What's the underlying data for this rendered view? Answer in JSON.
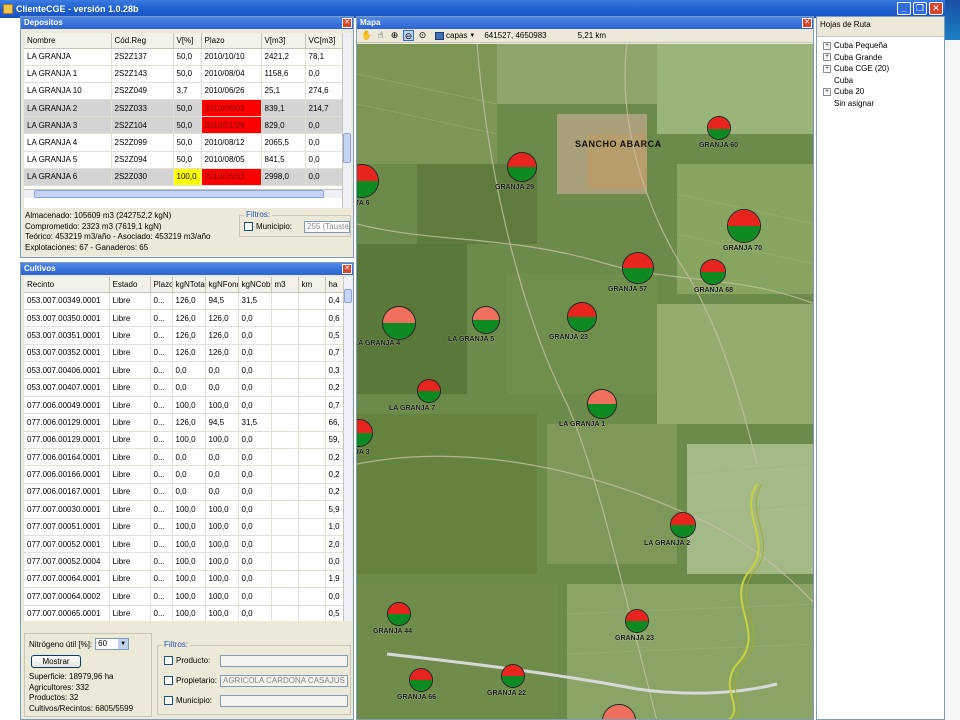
{
  "app": {
    "title": "ClienteCGE - versión 1.0.28b"
  },
  "window_controls": {
    "minimize": "_",
    "restore": "❐",
    "close": "✕"
  },
  "depositos": {
    "title": "Depositos",
    "columns": [
      "Nombre",
      "Cód.Reg",
      "V[%]",
      "Plazo",
      "V[m3]",
      "VC[m3]"
    ],
    "rows": [
      {
        "cells": [
          "LA GRANJA",
          "2S2Z137",
          "50,0",
          "2010/10/10",
          "2421,2",
          "78,1"
        ],
        "selected": false,
        "hl": [
          "",
          "",
          "",
          "",
          "",
          ""
        ]
      },
      {
        "cells": [
          "LA GRANJA 1",
          "2S2Z143",
          "50,0",
          "2010/08/04",
          "1158,6",
          "0,0"
        ],
        "selected": false,
        "hl": [
          "",
          "",
          "",
          "",
          "",
          ""
        ]
      },
      {
        "cells": [
          "LA GRANJA 10",
          "2S2Z049",
          "3,7",
          "2010/06/26",
          "25,1",
          "274,6"
        ],
        "selected": false,
        "hl": [
          "",
          "",
          "",
          "",
          "",
          ""
        ]
      },
      {
        "cells": [
          "LA GRANJA 2",
          "2S2Z033",
          "50,0",
          "2010/05/03",
          "839,1",
          "214,7"
        ],
        "selected": true,
        "hl": [
          "",
          "",
          "",
          "red",
          "",
          ""
        ]
      },
      {
        "cells": [
          "LA GRANJA 3",
          "2S2Z104",
          "50,0",
          "2010/01/29",
          "829,0",
          "0,0"
        ],
        "selected": true,
        "hl": [
          "",
          "",
          "",
          "red",
          "",
          ""
        ]
      },
      {
        "cells": [
          "LA GRANJA 4",
          "2S2Z099",
          "50,0",
          "2010/08/12",
          "2065,5",
          "0,0"
        ],
        "selected": false,
        "hl": [
          "",
          "",
          "",
          "",
          "",
          ""
        ]
      },
      {
        "cells": [
          "LA GRANJA 5",
          "2S2Z094",
          "50,0",
          "2010/08/05",
          "841,5",
          "0,0"
        ],
        "selected": false,
        "hl": [
          "",
          "",
          "",
          "",
          "",
          ""
        ]
      },
      {
        "cells": [
          "LA GRANJA 6",
          "2S2Z030",
          "100,0",
          "2010/06/03",
          "2998,0",
          "0,0"
        ],
        "selected": true,
        "hl": [
          "",
          "",
          "yellow",
          "red",
          "",
          ""
        ]
      }
    ],
    "summary": [
      "Almacenado: 105609 m3 (242752,2 kgN)",
      "Comprometido: 2323 m3 (7619,1 kgN)",
      "Teórico: 453219 m3/año - Asociado: 453219 m3/año",
      "Explotaciones: 67 - Ganaderos: 65"
    ],
    "filters": {
      "legend": "Filtros:",
      "municipio_label": "Municipio:",
      "municipio_value": "255 (Tauste)"
    }
  },
  "cultivos": {
    "title": "Cultivos",
    "columns": [
      "Recinto",
      "Estado",
      "Plazo",
      "kgNTotal",
      "kgNFondo",
      "kgNCob.",
      "m3",
      "km",
      "ha"
    ],
    "rows": [
      [
        "053.007.00349.0001",
        "Libre",
        "0...",
        "126,0",
        "94,5",
        "31,5",
        "",
        "",
        "0,4"
      ],
      [
        "053.007.00350.0001",
        "Libre",
        "0...",
        "126,0",
        "126,0",
        "0,0",
        "",
        "",
        "0,6"
      ],
      [
        "053.007.00351.0001",
        "Libre",
        "0...",
        "126,0",
        "126,0",
        "0,0",
        "",
        "",
        "0,5"
      ],
      [
        "053.007.00352.0001",
        "Libre",
        "0...",
        "126,0",
        "126,0",
        "0,0",
        "",
        "",
        "0,7"
      ],
      [
        "053.007.00406.0001",
        "Libre",
        "0...",
        "0,0",
        "0,0",
        "0,0",
        "",
        "",
        "0,3"
      ],
      [
        "053.007.00407.0001",
        "Libre",
        "0...",
        "0,0",
        "0,0",
        "0,0",
        "",
        "",
        "0,2"
      ],
      [
        "077.006.00049.0001",
        "Libre",
        "0...",
        "100,0",
        "100,0",
        "0,0",
        "",
        "",
        "0,7"
      ],
      [
        "077.006.00129.0001",
        "Libre",
        "0...",
        "126,0",
        "94,5",
        "31,5",
        "",
        "",
        "66,"
      ],
      [
        "077.006.00129.0001",
        "Libre",
        "0...",
        "100,0",
        "100,0",
        "0,0",
        "",
        "",
        "59,"
      ],
      [
        "077.006.00164.0001",
        "Libre",
        "0...",
        "0,0",
        "0,0",
        "0,0",
        "",
        "",
        "0,2"
      ],
      [
        "077.006.00166.0001",
        "Libre",
        "0...",
        "0,0",
        "0,0",
        "0,0",
        "",
        "",
        "0,2"
      ],
      [
        "077.006.00167.0001",
        "Libre",
        "0...",
        "0,0",
        "0,0",
        "0,0",
        "",
        "",
        "0,2"
      ],
      [
        "077.007.00030.0001",
        "Libre",
        "0...",
        "100,0",
        "100,0",
        "0,0",
        "",
        "",
        "5,9"
      ],
      [
        "077.007.00051.0001",
        "Libre",
        "0...",
        "100,0",
        "100,0",
        "0,0",
        "",
        "",
        "1,0"
      ],
      [
        "077.007.00052.0001",
        "Libre",
        "0...",
        "100,0",
        "100,0",
        "0,0",
        "",
        "",
        "2,0"
      ],
      [
        "077.007.00052.0004",
        "Libre",
        "0...",
        "100,0",
        "100,0",
        "0,0",
        "",
        "",
        "0,0"
      ],
      [
        "077.007.00064.0001",
        "Libre",
        "0...",
        "100,0",
        "100,0",
        "0,0",
        "",
        "",
        "1,9"
      ],
      [
        "077.007.00064.0002",
        "Libre",
        "0...",
        "100,0",
        "100,0",
        "0,0",
        "",
        "",
        "0,0"
      ],
      [
        "077.007.00065.0001",
        "Libre",
        "0...",
        "100,0",
        "100,0",
        "0,0",
        "",
        "",
        "0,5"
      ]
    ],
    "nitrogeno_label": "Nitrógeno útil [%]:",
    "nitrogeno_value": "60",
    "mostrar_label": "Mostrar",
    "summary": [
      "Superficie: 18979,96 ha",
      "Agricultores: 332",
      "Productos: 32",
      "Cultivos/Recintos: 6805/5599"
    ],
    "filters": {
      "legend": "Filtros:",
      "producto_label": "Producto:",
      "propietario_label": "Propietario:",
      "propietario_value": "AGRICOLA CARDONA CASAJUS S",
      "municipio_label": "Municipio:"
    }
  },
  "mapa": {
    "title": "Mapa",
    "tool_icons": [
      "hand-icon",
      "pan-icon",
      "zoom-in-icon",
      "zoom-out-icon",
      "zoom-extent-icon"
    ],
    "layers_label": "capas",
    "coords": "641527, 4650983",
    "scale": "5,21 km",
    "place_label": "SANCHO ABARCA",
    "markers": [
      {
        "label": "GRANJA 60",
        "top_color": "#e8241f",
        "fill": 0.55
      },
      {
        "label": "GRANJA 29",
        "top_color": "#e8241f",
        "fill": 0.5
      },
      {
        "label": "GRANJA 70",
        "top_color": "#e8241f",
        "fill": 0.5
      },
      {
        "label": "GRANJA 57",
        "top_color": "#e8241f",
        "fill": 0.5
      },
      {
        "label": "GRANJA 68",
        "top_color": "#e8241f",
        "fill": 0.5
      },
      {
        "label": "LA GRANJA 4",
        "top_color": "#f07060",
        "fill": 0.5
      },
      {
        "label": "LA GRANJA 5",
        "top_color": "#f07060",
        "fill": 0.5
      },
      {
        "label": "GRANJA 23",
        "top_color": "#e8241f",
        "fill": 0.5
      },
      {
        "label": "LA GRANJA 7",
        "top_color": "#e8241f",
        "fill": 0.5
      },
      {
        "label": "LA GRANJA 1",
        "top_color": "#f07060",
        "fill": 0.5
      },
      {
        "label": "LA GRANJA 2",
        "top_color": "#e8241f",
        "fill": 0.5
      },
      {
        "label": "GRANJA 44",
        "top_color": "#e8241f",
        "fill": 0.5
      },
      {
        "label": "GRANJA 23",
        "top_color": "#e8241f",
        "fill": 0.5
      },
      {
        "label": "GRANJA 66",
        "top_color": "#e8241f",
        "fill": 0.5
      },
      {
        "label": "GRANJA 22",
        "top_color": "#e8241f",
        "fill": 0.5
      },
      {
        "label": "JA 6",
        "top_color": "#e8241f",
        "fill": 0.5
      },
      {
        "label": "JA 3",
        "top_color": "#e8241f",
        "fill": 0.5
      },
      {
        "label": "",
        "top_color": "#f07060",
        "fill": 0.5
      }
    ]
  },
  "hojas_ruta": {
    "title": "Hojas de Ruta",
    "items": [
      {
        "label": "Cuba Pequeña",
        "expandable": true
      },
      {
        "label": "Cuba Grande",
        "expandable": true
      },
      {
        "label": "Cuba CGE (20)",
        "expandable": true
      },
      {
        "label": "Cuba",
        "expandable": false
      },
      {
        "label": "Cuba 20",
        "expandable": true
      },
      {
        "label": "Sin asignar",
        "expandable": false
      }
    ]
  }
}
